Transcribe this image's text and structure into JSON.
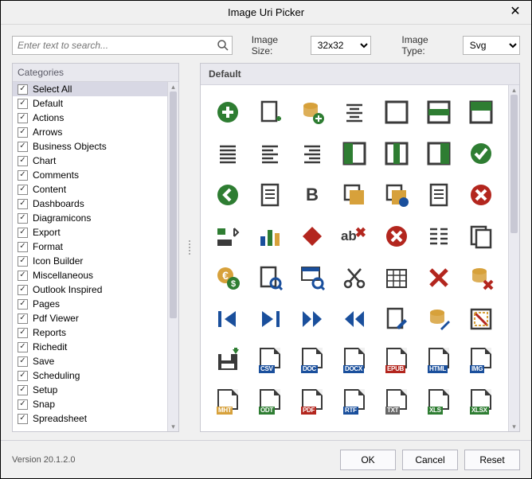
{
  "window": {
    "title": "Image Uri Picker",
    "close_glyph": "✕"
  },
  "search": {
    "placeholder": "Enter text to search..."
  },
  "controls": {
    "size_label": "Image Size:",
    "size_value": "32x32",
    "type_label": "Image Type:",
    "type_value": "Svg"
  },
  "categories": {
    "header": "Categories",
    "items": [
      "Select All",
      "Default",
      "Actions",
      "Arrows",
      "Business Objects",
      "Chart",
      "Comments",
      "Content",
      "Dashboards",
      "Diagramicons",
      "Export",
      "Format",
      "Icon Builder",
      "Miscellaneous",
      "Outlook Inspired",
      "Pages",
      "Pdf Viewer",
      "Reports",
      "Richedit",
      "Save",
      "Scheduling",
      "Setup",
      "Snap",
      "Spreadsheet"
    ],
    "selected": 0
  },
  "icon_panel": {
    "header": "Default",
    "icons": [
      {
        "name": "add-circle",
        "kind": "add-circle"
      },
      {
        "name": "add-page",
        "kind": "page-plus"
      },
      {
        "name": "add-database",
        "kind": "db",
        "color": "#d7a13b",
        "overlay": "plus"
      },
      {
        "name": "align-center",
        "kind": "align-center"
      },
      {
        "name": "box-outline",
        "kind": "box",
        "fill": "none"
      },
      {
        "name": "box-half-h",
        "kind": "box-h",
        "color": "#2e7d32"
      },
      {
        "name": "box-top",
        "kind": "box-top",
        "color": "#2e7d32"
      },
      {
        "name": "align-justify",
        "kind": "align-justify"
      },
      {
        "name": "align-left",
        "kind": "align-left"
      },
      {
        "name": "align-right",
        "kind": "align-right"
      },
      {
        "name": "box-left",
        "kind": "box-left",
        "color": "#2e7d32"
      },
      {
        "name": "box-middle-v",
        "kind": "box-mid",
        "color": "#2e7d32"
      },
      {
        "name": "box-right",
        "kind": "box-right",
        "color": "#2e7d32"
      },
      {
        "name": "apply-check",
        "kind": "check-circle",
        "color": "#2e7d32"
      },
      {
        "name": "back-circle",
        "kind": "arrow-circle-l",
        "color": "#2e7d32"
      },
      {
        "name": "page-lines",
        "kind": "page-lines"
      },
      {
        "name": "bold",
        "kind": "bold"
      },
      {
        "name": "layer-back",
        "kind": "layers",
        "front": "#d7a13b",
        "back": "#3a3a3a"
      },
      {
        "name": "layer-front",
        "kind": "layers",
        "front": "#d7a13b",
        "back": "#3a3a3a",
        "dot": "#1a4f9c"
      },
      {
        "name": "page-text",
        "kind": "page-lines"
      },
      {
        "name": "cancel-circle",
        "kind": "x-circle",
        "color": "#b3261e"
      },
      {
        "name": "ruler-swap",
        "kind": "ruler"
      },
      {
        "name": "chart-bars",
        "kind": "chart"
      },
      {
        "name": "eraser",
        "kind": "diamond",
        "color": "#b3261e"
      },
      {
        "name": "clear-text",
        "kind": "ab"
      },
      {
        "name": "cancel-circle-2",
        "kind": "x-circle",
        "color": "#b3261e"
      },
      {
        "name": "list-lines",
        "kind": "lines"
      },
      {
        "name": "copy-page",
        "kind": "page-copy"
      },
      {
        "name": "currency-euro",
        "kind": "coin",
        "text": "€",
        "overlay": "$",
        "color": "#d7a13b",
        "overcolor": "#2e7d32"
      },
      {
        "name": "page-wrench",
        "kind": "page-tool",
        "tool": "wrench"
      },
      {
        "name": "table-wrench",
        "kind": "table-tool"
      },
      {
        "name": "cut-scissors",
        "kind": "scissors"
      },
      {
        "name": "date-grid",
        "kind": "grid"
      },
      {
        "name": "delete-x",
        "kind": "x",
        "color": "#b3261e"
      },
      {
        "name": "delete-database",
        "kind": "db",
        "color": "#d7a13b",
        "overlay": "x",
        "overcolor": "#b3261e"
      },
      {
        "name": "skip-first",
        "kind": "skip-first",
        "color": "#1a4f9c"
      },
      {
        "name": "skip-last",
        "kind": "skip-last",
        "color": "#1a4f9c"
      },
      {
        "name": "play-double",
        "kind": "play-dbl",
        "color": "#1a4f9c"
      },
      {
        "name": "rewind-double",
        "kind": "rew-dbl",
        "color": "#1a4f9c"
      },
      {
        "name": "edit-page",
        "kind": "page-pencil"
      },
      {
        "name": "edit-database",
        "kind": "db",
        "color": "#d7a13b",
        "overlay": "pencil"
      },
      {
        "name": "crop-image",
        "kind": "crop"
      },
      {
        "name": "save-export",
        "kind": "floppy",
        "arrow": "#2e7d32"
      },
      {
        "name": "file-csv",
        "kind": "filebadge",
        "tag": "CSV",
        "bg": "#1a4f9c"
      },
      {
        "name": "file-doc",
        "kind": "filebadge",
        "tag": "DOC",
        "bg": "#1a4f9c"
      },
      {
        "name": "file-docx",
        "kind": "filebadge",
        "tag": "DOCX",
        "bg": "#1a4f9c"
      },
      {
        "name": "file-epub",
        "kind": "filebadge",
        "tag": "EPUB",
        "bg": "#b3261e"
      },
      {
        "name": "file-html",
        "kind": "filebadge",
        "tag": "HTML",
        "bg": "#1a4f9c"
      },
      {
        "name": "file-img",
        "kind": "filebadge",
        "tag": "IMG",
        "bg": "#1a4f9c"
      },
      {
        "name": "file-mht",
        "kind": "filebadge",
        "tag": "MHT",
        "bg": "#d7a13b"
      },
      {
        "name": "file-odt",
        "kind": "filebadge",
        "tag": "ODT",
        "bg": "#2e7d32"
      },
      {
        "name": "file-pdf",
        "kind": "filebadge",
        "tag": "PDF",
        "bg": "#b3261e"
      },
      {
        "name": "file-rtf",
        "kind": "filebadge",
        "tag": "RTF",
        "bg": "#1a4f9c"
      },
      {
        "name": "file-txt",
        "kind": "filebadge",
        "tag": "TXT",
        "bg": "#666"
      },
      {
        "name": "file-xls",
        "kind": "filebadge",
        "tag": "XLS",
        "bg": "#2e7d32"
      },
      {
        "name": "file-xlsx",
        "kind": "filebadge",
        "tag": "XLSX",
        "bg": "#2e7d32"
      }
    ]
  },
  "footer": {
    "version": "Version 20.1.2.0",
    "ok": "OK",
    "cancel": "Cancel",
    "reset": "Reset"
  },
  "colors": {
    "green": "#2e7d32",
    "red": "#b3261e",
    "blue": "#1a4f9c",
    "amber": "#d7a13b",
    "ink": "#3a3a3a"
  }
}
